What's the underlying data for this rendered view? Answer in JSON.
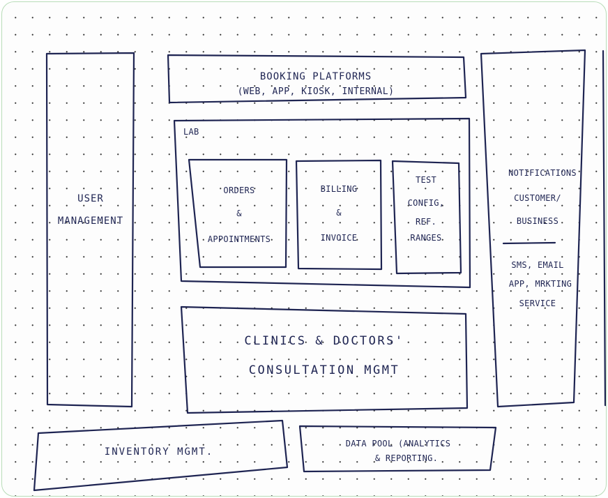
{
  "diagram": {
    "user_management": "USER MANAGEMENT",
    "booking": {
      "title": "BOOKING PLATFORMS",
      "subtitle": "(WEB, APP, KIOSK, INTERNAL)"
    },
    "lab": {
      "title": "LAB",
      "orders": {
        "line1": "ORDERS",
        "line2": "&",
        "line3": "APPOINTMENTS"
      },
      "billing": {
        "line1": "BILLING",
        "line2": "&",
        "line3": "INVOICE"
      },
      "test_config": {
        "line1": "TEST",
        "line2": "CONFIG,",
        "line3": "REF.",
        "line4": "RANGES"
      }
    },
    "clinics": {
      "line1": "CLINICS & DOCTORS'",
      "line2": "CONSULTATION MGMT"
    },
    "notifications": {
      "line1": "NOTIFICATIONS",
      "line2": "CUSTOMER/",
      "line3": "BUSINESS",
      "line4": "SMS, EMAIL",
      "line5": "APP, MRKTING",
      "line6": "SERVICE"
    },
    "inventory": "INVENTORY MGMT.",
    "data_pool": {
      "line1": "DATA POOL (ANALYTICS",
      "line2": "& REPORTING."
    }
  }
}
